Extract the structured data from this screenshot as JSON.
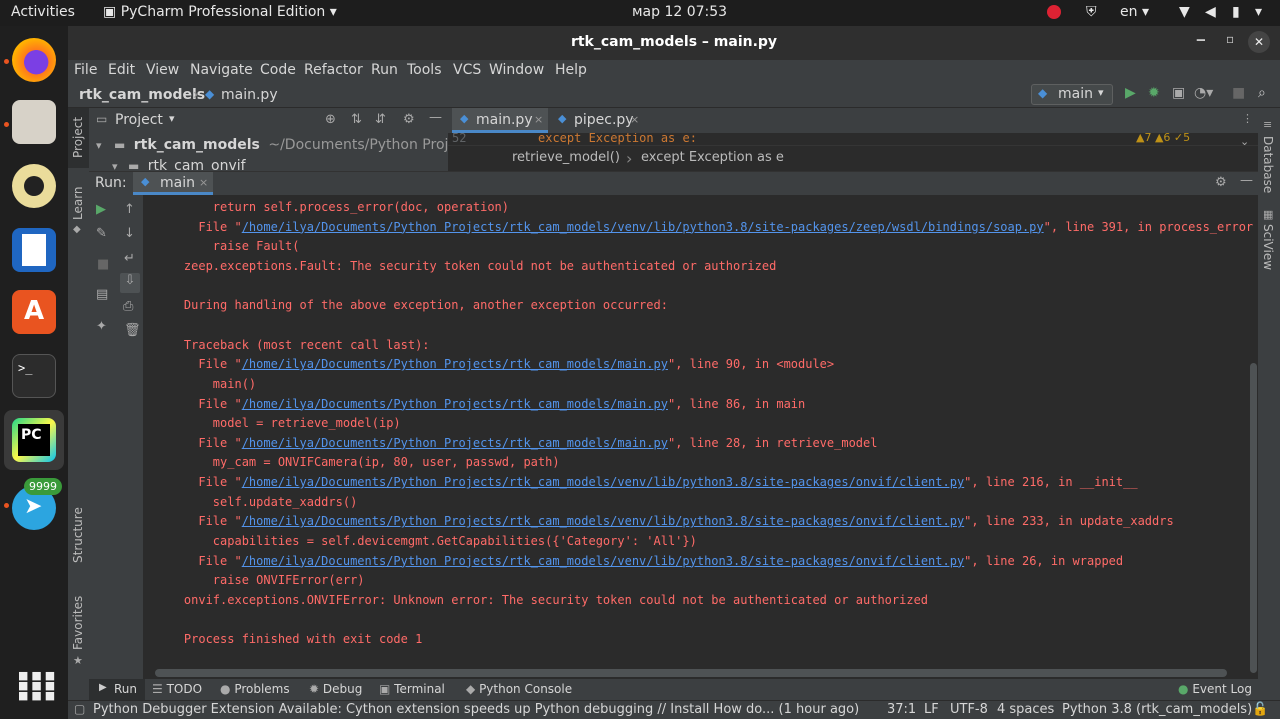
{
  "topbar": {
    "activities": "Activities",
    "app_menu": "PyCharm Professional Edition",
    "clock": "мар 12  07:53",
    "lang": "en"
  },
  "dock": {
    "badge": "9999"
  },
  "window": {
    "title": "rtk_cam_models – main.py"
  },
  "menu": [
    "File",
    "Edit",
    "View",
    "Navigate",
    "Code",
    "Refactor",
    "Run",
    "Tools",
    "VCS",
    "Window",
    "Help"
  ],
  "nav": {
    "project": "rtk_cam_models",
    "file": "main.py",
    "run_config": "main"
  },
  "project_panel": {
    "title": "Project",
    "root": "rtk_cam_models",
    "root_path": "~/Documents/Python Projects/r",
    "child": "rtk_cam_onvif"
  },
  "left_strip": {
    "project": "Project",
    "learn": "Learn",
    "structure": "Structure",
    "favorites": "Favorites"
  },
  "right_strip": {
    "database": "Database",
    "sciview": "SciView"
  },
  "editor": {
    "tab1": "main.py",
    "tab2": "pipec.py",
    "line_no": "52",
    "line": "except Exception as e:",
    "crumb1": "retrieve_model()",
    "crumb2": "except Exception as e",
    "warn": "▲7  ▲6  ✓5"
  },
  "run": {
    "label": "Run:",
    "tab": "main"
  },
  "console": [
    {
      "t": "        return self.process_error(doc, operation)"
    },
    {
      "t": "      File \"",
      "link": "/home/ilya/Documents/Python Projects/rtk_cam_models/venv/lib/python3.8/site-packages/zeep/wsdl/bindings/soap.py",
      "tail": "\", line 391, in process_error"
    },
    {
      "t": "        raise Fault("
    },
    {
      "t": "    zeep.exceptions.Fault: The security token could not be authenticated or authorized"
    },
    {
      "t": ""
    },
    {
      "t": "    During handling of the above exception, another exception occurred:"
    },
    {
      "t": ""
    },
    {
      "t": "    Traceback (most recent call last):"
    },
    {
      "t": "      File \"",
      "link": "/home/ilya/Documents/Python Projects/rtk_cam_models/main.py",
      "tail": "\", line 90, in <module>"
    },
    {
      "t": "        main()"
    },
    {
      "t": "      File \"",
      "link": "/home/ilya/Documents/Python Projects/rtk_cam_models/main.py",
      "tail": "\", line 86, in main"
    },
    {
      "t": "        model = retrieve_model(ip)"
    },
    {
      "t": "      File \"",
      "link": "/home/ilya/Documents/Python Projects/rtk_cam_models/main.py",
      "tail": "\", line 28, in retrieve_model"
    },
    {
      "t": "        my_cam = ONVIFCamera(ip, 80, user, passwd, path)"
    },
    {
      "t": "      File \"",
      "link": "/home/ilya/Documents/Python Projects/rtk_cam_models/venv/lib/python3.8/site-packages/onvif/client.py",
      "tail": "\", line 216, in __init__"
    },
    {
      "t": "        self.update_xaddrs()"
    },
    {
      "t": "      File \"",
      "link": "/home/ilya/Documents/Python Projects/rtk_cam_models/venv/lib/python3.8/site-packages/onvif/client.py",
      "tail": "\", line 233, in update_xaddrs"
    },
    {
      "t": "        capabilities = self.devicemgmt.GetCapabilities({'Category': 'All'})"
    },
    {
      "t": "      File \"",
      "link": "/home/ilya/Documents/Python Projects/rtk_cam_models/venv/lib/python3.8/site-packages/onvif/client.py",
      "tail": "\", line 26, in wrapped"
    },
    {
      "t": "        raise ONVIFError(err)"
    },
    {
      "t": "    onvif.exceptions.ONVIFError: Unknown error: The security token could not be authenticated or authorized"
    },
    {
      "t": ""
    },
    {
      "t": "    Process finished with exit code 1"
    }
  ],
  "bottom_tabs": {
    "run": "Run",
    "todo": "TODO",
    "problems": "Problems",
    "debug": "Debug",
    "terminal": "Terminal",
    "python_console": "Python Console",
    "event_log": "Event Log"
  },
  "status": {
    "message": "Python Debugger Extension Available: Cython extension speeds up Python debugging // Install  How do... (1 hour ago)",
    "pos": "37:1",
    "lf": "LF",
    "enc": "UTF-8",
    "indent": "4 spaces",
    "interp": "Python 3.8 (rtk_cam_models)"
  },
  "colors": {
    "error": "#ff6b68",
    "link": "#5394ec",
    "bg": "#2b2b2b",
    "panel": "#3c3f41"
  }
}
